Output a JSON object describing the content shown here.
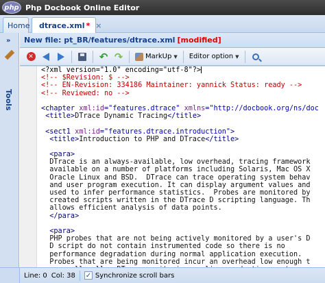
{
  "window": {
    "logo_text": "php",
    "title": "Php Docbook Online Editor"
  },
  "tabs": [
    {
      "label": "Home"
    },
    {
      "label": "dtrace.xml",
      "modified_mark": "*",
      "close": "×"
    }
  ],
  "sidebar": {
    "collapse_glyph": "»",
    "label": "Tools"
  },
  "file_header": {
    "text": "New file: pt_BR/features/dtrace.xml",
    "status": "[modified]"
  },
  "toolbar": {
    "close_glyph": "✕",
    "markup_label": "MarkUp",
    "editor_option_label": "Editor option"
  },
  "code_lines": [
    [
      [
        "pi",
        "<?xml version=\"1.0\" encoding=\"utf-8\"?>"
      ]
    ],
    [
      [
        "cm",
        "<!-- $Revision: $ -->"
      ]
    ],
    [
      [
        "cm",
        "<!-- EN-Revision: 334186 Maintainer: yannick Status: ready -->"
      ]
    ],
    [
      [
        "cm",
        "<!-- Reviewed: no -->"
      ]
    ],
    [
      [
        "tx",
        ""
      ]
    ],
    [
      [
        "tg",
        "<chapter "
      ],
      [
        "at",
        "xml:id"
      ],
      [
        "tg",
        "="
      ],
      [
        "vl",
        "\"features.dtrace\""
      ],
      [
        "tg",
        " "
      ],
      [
        "at",
        "xmlns"
      ],
      [
        "tg",
        "="
      ],
      [
        "vl",
        "\"http://docbook.org/ns/doc"
      ]
    ],
    [
      [
        "tg",
        " <title>"
      ],
      [
        "tx",
        "DTrace Dynamic Tracing"
      ],
      [
        "tg",
        "</title>"
      ]
    ],
    [
      [
        "tx",
        ""
      ]
    ],
    [
      [
        "tg",
        " <sect1 "
      ],
      [
        "at",
        "xml:id"
      ],
      [
        "tg",
        "="
      ],
      [
        "vl",
        "\"features.dtrace.introduction\""
      ],
      [
        "tg",
        ">"
      ]
    ],
    [
      [
        "tg",
        "  <title>"
      ],
      [
        "tx",
        "Introduction to PHP and DTrace"
      ],
      [
        "tg",
        "</title>"
      ]
    ],
    [
      [
        "tx",
        ""
      ]
    ],
    [
      [
        "tg",
        "  <para>"
      ]
    ],
    [
      [
        "tx",
        "  DTrace is an always-available, low overhead, tracing framework"
      ]
    ],
    [
      [
        "tx",
        "  available on a number of platforms including Solaris, Mac OS X"
      ]
    ],
    [
      [
        "tx",
        "  Oracle Linux and BSD.  DTrace can trace operating system behav"
      ]
    ],
    [
      [
        "tx",
        "  and user program execution. It can display argument values and"
      ]
    ],
    [
      [
        "tx",
        "  used to infer performance statistics.  Probes are monitored by"
      ]
    ],
    [
      [
        "tx",
        "  created scripts written in the DTrace D scripting language. Th"
      ]
    ],
    [
      [
        "tx",
        "  allows efficient analysis of data points."
      ]
    ],
    [
      [
        "tg",
        "  </para>"
      ]
    ],
    [
      [
        "tx",
        ""
      ]
    ],
    [
      [
        "tg",
        "  <para>"
      ]
    ],
    [
      [
        "tx",
        "  PHP probes that are not being actively monitored by a user's D"
      ]
    ],
    [
      [
        "tx",
        "  D script do not contain instrumented code so there is no"
      ]
    ],
    [
      [
        "tx",
        "  performance degradation during normal application execution."
      ]
    ],
    [
      [
        "tx",
        "  Probes that are being monitored incur an overhead low enough t"
      ]
    ],
    [
      [
        "tx",
        "  generally allow DTrace monitoring on live production systems"
      ]
    ]
  ],
  "status": {
    "line": "Line: 0",
    "col": "Col: 38",
    "sync_label": "Synchronize scroll bars",
    "sync_checked": "✓"
  }
}
